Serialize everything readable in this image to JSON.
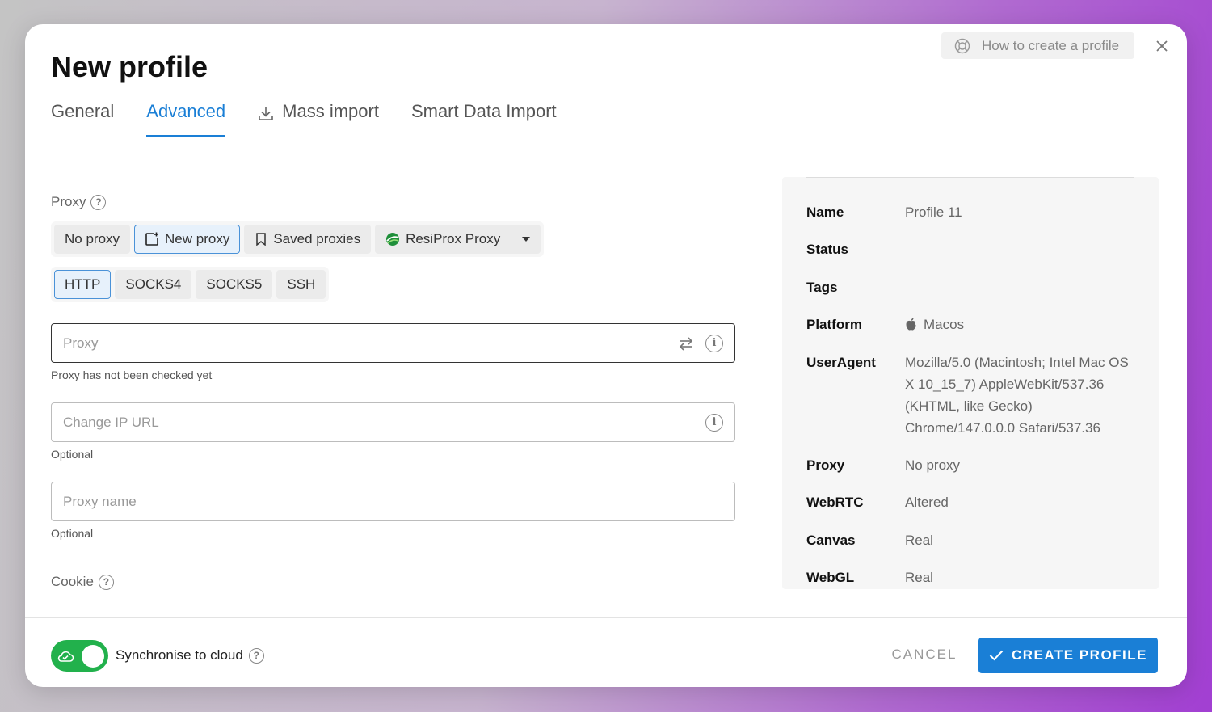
{
  "modal": {
    "title": "New profile",
    "help_label": "How to create a profile"
  },
  "tabs": [
    {
      "label": "General",
      "active": false
    },
    {
      "label": "Advanced",
      "active": true
    },
    {
      "label": "Mass import",
      "active": false
    },
    {
      "label": "Smart Data Import",
      "active": false
    }
  ],
  "proxy": {
    "section_label": "Proxy",
    "modes": [
      {
        "label": "No proxy",
        "selected": false
      },
      {
        "label": "New proxy",
        "selected": true
      },
      {
        "label": "Saved proxies",
        "selected": false
      },
      {
        "label": "ResiProx Proxy",
        "selected": false
      }
    ],
    "protocols": [
      {
        "label": "HTTP",
        "selected": true
      },
      {
        "label": "SOCKS4",
        "selected": false
      },
      {
        "label": "SOCKS5",
        "selected": false
      },
      {
        "label": "SSH",
        "selected": false
      }
    ],
    "proxy_field": {
      "placeholder": "Proxy",
      "value": "",
      "helper": "Proxy has not been checked yet"
    },
    "change_ip_field": {
      "placeholder": "Change IP URL",
      "value": "",
      "helper": "Optional"
    },
    "proxy_name_field": {
      "placeholder": "Proxy name",
      "value": "",
      "helper": "Optional"
    }
  },
  "cookie": {
    "section_label": "Cookie"
  },
  "summary": [
    {
      "key": "Name",
      "value": "Profile 11"
    },
    {
      "key": "Status",
      "value": ""
    },
    {
      "key": "Tags",
      "value": ""
    },
    {
      "key": "Platform",
      "value": "Macos",
      "icon": "apple-icon"
    },
    {
      "key": "UserAgent",
      "value": "Mozilla/5.0 (Macintosh; Intel Mac OS X 10_15_7) AppleWebKit/537.36 (KHTML, like Gecko) Chrome/147.0.0.0 Safari/537.36"
    },
    {
      "key": "Proxy",
      "value": "No proxy"
    },
    {
      "key": "WebRTC",
      "value": "Altered"
    },
    {
      "key": "Canvas",
      "value": "Real"
    },
    {
      "key": "WebGL",
      "value": "Real"
    }
  ],
  "footer": {
    "sync_label": "Synchronise to cloud",
    "sync_enabled": true,
    "cancel_label": "CANCEL",
    "create_label": "CREATE PROFILE"
  },
  "colors": {
    "accent": "#1a7fd6",
    "toggle_on": "#22b14c"
  }
}
